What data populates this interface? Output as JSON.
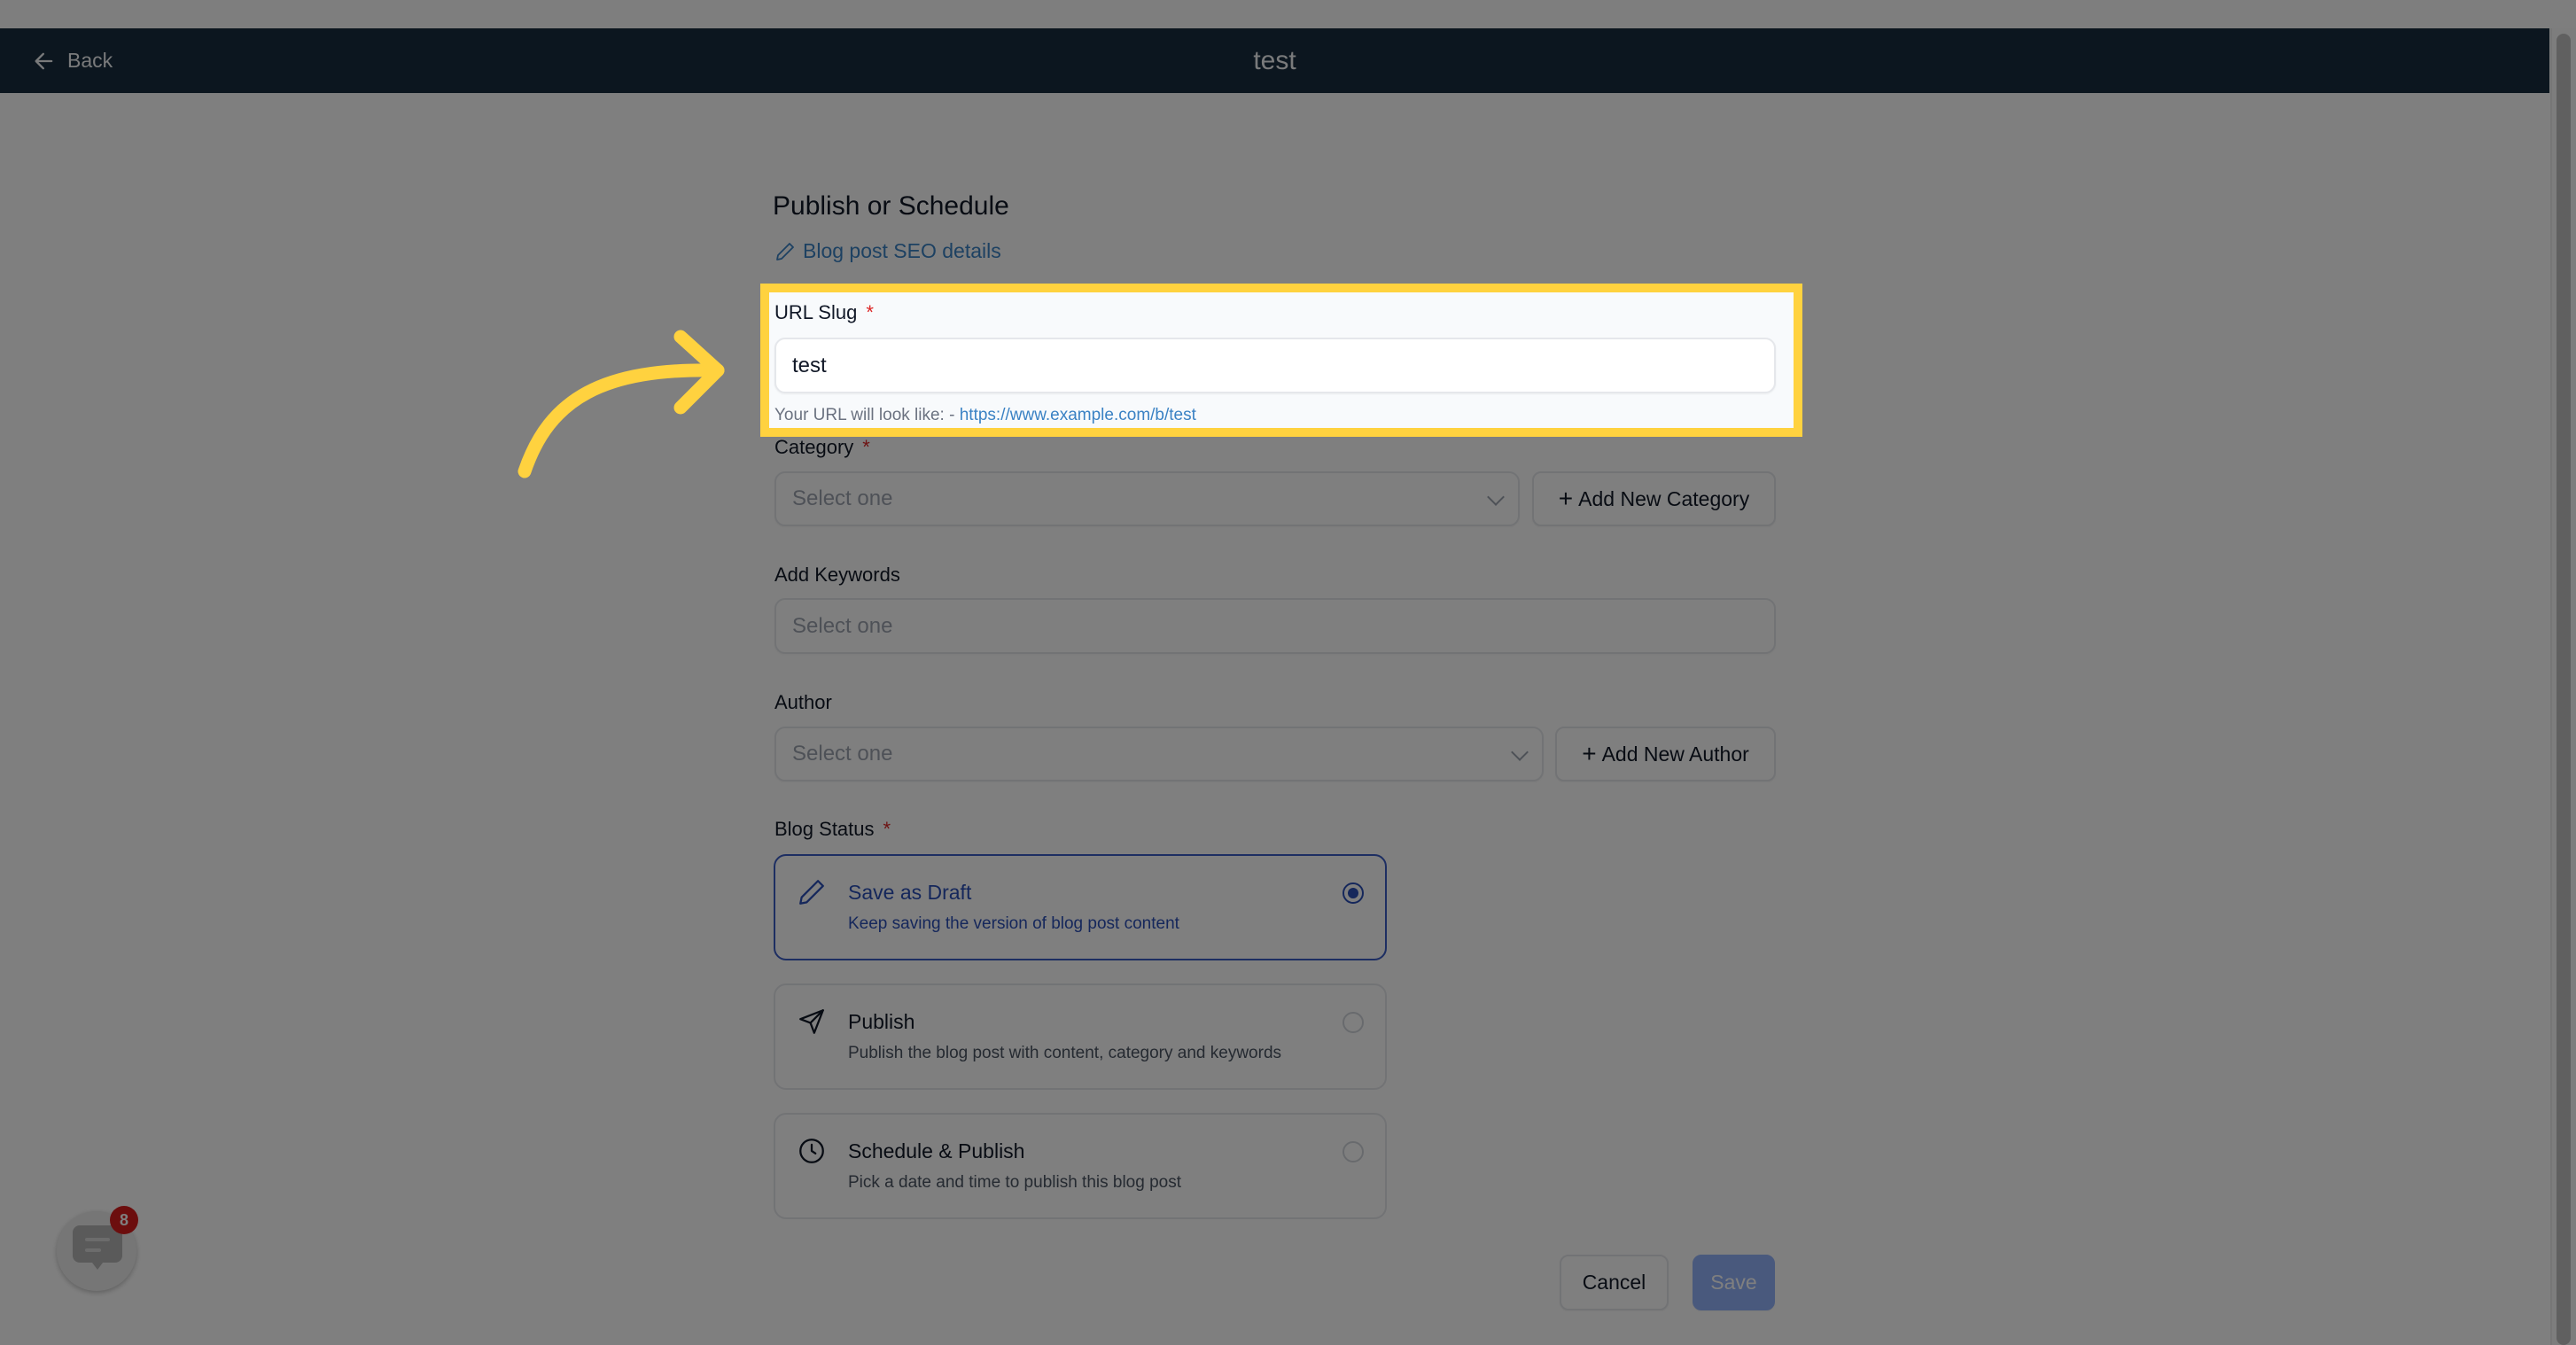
{
  "header": {
    "back_label": "Back",
    "title": "test"
  },
  "form": {
    "heading": "Publish or Schedule",
    "seo_link": "Blog post SEO details",
    "url_slug": {
      "label": "URL Slug",
      "required_mark": "*",
      "value": "test",
      "hint_prefix": "Your URL will look like: - ",
      "hint_url": "https://www.example.com/b/test"
    },
    "category": {
      "label": "Category",
      "required_mark": "*",
      "placeholder": "Select one",
      "add_button": "Add New Category"
    },
    "keywords": {
      "label": "Add Keywords",
      "placeholder": "Select one"
    },
    "author": {
      "label": "Author",
      "placeholder": "Select one",
      "add_button": "Add New Author"
    },
    "blog_status": {
      "label": "Blog Status",
      "required_mark": "*",
      "selected": "draft",
      "options": [
        {
          "id": "draft",
          "title": "Save as Draft",
          "description": "Keep saving the version of blog post content",
          "icon": "pencil-icon"
        },
        {
          "id": "publish",
          "title": "Publish",
          "description": "Publish the blog post with content, category and keywords",
          "icon": "send-icon"
        },
        {
          "id": "schedule",
          "title": "Schedule & Publish",
          "description": "Pick a date and time to publish this blog post",
          "icon": "clock-icon"
        }
      ]
    },
    "actions": {
      "cancel": "Cancel",
      "save": "Save"
    }
  },
  "chat_widget": {
    "badge_count": "8"
  },
  "annotation": {
    "highlight_color": "#FFD23F"
  }
}
